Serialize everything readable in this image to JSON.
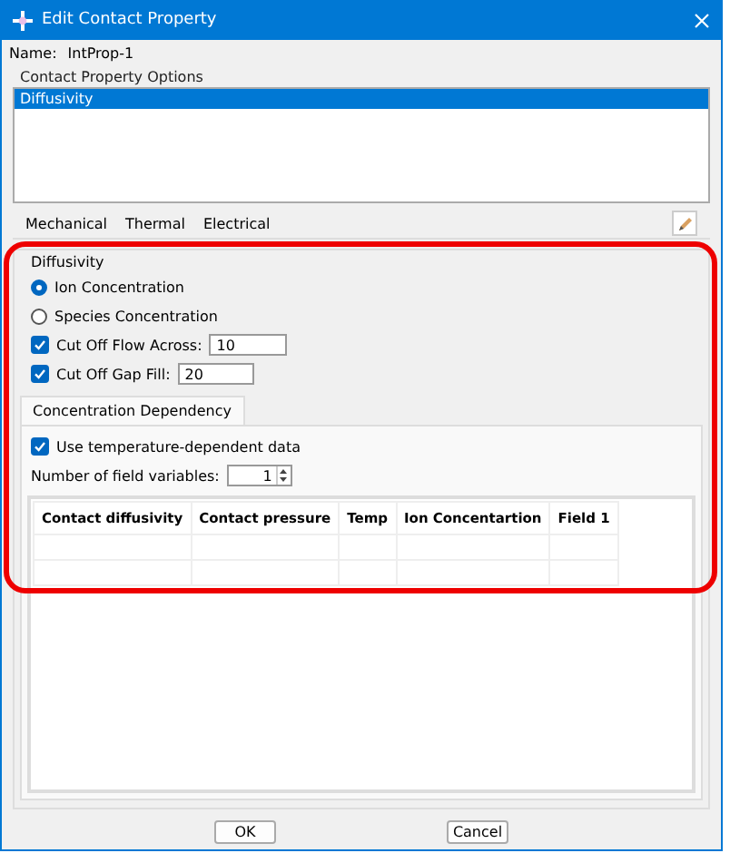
{
  "window": {
    "title": "Edit Contact Property"
  },
  "name": {
    "label": "Name:",
    "value": "IntProp-1"
  },
  "options": {
    "title": "Contact Property Options",
    "items": [
      {
        "label": "Diffusivity",
        "selected": true
      }
    ]
  },
  "menu": [
    {
      "label": "Mechanical"
    },
    {
      "label": "Thermal"
    },
    {
      "label": "Electrical"
    }
  ],
  "diffusivity": {
    "title": "Diffusivity",
    "radios": [
      {
        "label": "Ion Concentration",
        "selected": true
      },
      {
        "label": "Species Concentration",
        "selected": false
      }
    ],
    "cutoffs": [
      {
        "label": "Cut Off Flow Across:",
        "checked": true,
        "value": "10"
      },
      {
        "label": "Cut Off Gap Fill:",
        "checked": true,
        "value": "20"
      }
    ],
    "tabs": [
      {
        "label": "Concentration Dependency",
        "selected": true
      }
    ],
    "temp_dependent": {
      "label": "Use temperature-dependent data",
      "checked": true
    },
    "field_variables": {
      "label": "Number of field variables:",
      "value": "1"
    },
    "table": {
      "columns": [
        "Contact diffusivity",
        "Contact pressure",
        "Temp",
        "Ion Concentartion",
        "Field 1"
      ]
    }
  },
  "buttons": [
    "OK",
    "Cancel"
  ]
}
